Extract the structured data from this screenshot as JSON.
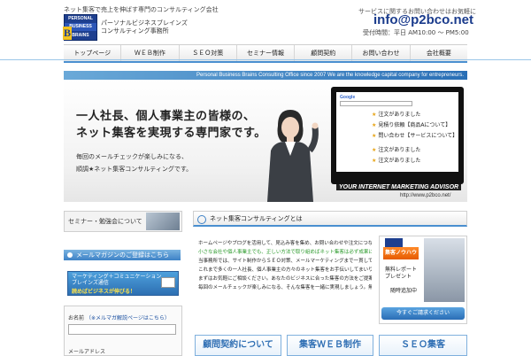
{
  "header": {
    "top_tagline": "ネット集客で売上を伸ばす専門のコンサルティング会社",
    "logo_lines": [
      "PERSONAL",
      "BUSINESS",
      "BRAINS"
    ],
    "logo_big_letter": "B",
    "logo_text_1": "パーソナルビジネスブレインズ",
    "logo_text_2": "コンサルティング事務所",
    "contact_note": "サービスに関するお問い合わせはお気軽に",
    "email": "info@p2bco.net",
    "hours": "受付時間：平日 AM10:00 〜 PM5:00"
  },
  "nav": {
    "items": [
      "トップページ",
      "ＷＥＢ制作",
      "ＳＥＯ対策",
      "セミナー情報",
      "顧問契約",
      "お問い合わせ",
      "会社概要"
    ]
  },
  "banner": {
    "strip_text": "Personal Business Brains Consulting Office since 2007  We are the knowledge capital company for entrepreneurs.",
    "headline_1": "一人社長、個人事業主の皆様の、",
    "headline_2": "ネット集客を実現する専門家です。",
    "sub_1": "毎回のメールチェックが楽しみになる、",
    "sub_2": "順調★ネット集客コンサルティングです。",
    "screen_logo": "Google",
    "screen_rows": [
      "注文がありました",
      "見積り依頼【商品Aについて】",
      "問い合わせ【サービスについて】",
      "注文がありました",
      "注文がありました"
    ],
    "caption": "YOUR INTERNET MARKETING ADVISOR",
    "url": "http://www.p2bco.net/"
  },
  "sidebar": {
    "seminar_label": "セミナー・勉強会について",
    "mail_head": "メールマガジンのご登録はこちら",
    "mail_banner_1": "マーケティング＋コミュニケーション",
    "mail_banner_2": "ブレインズ通信",
    "mail_banner_3": "読めばビジネスが伸びる！",
    "form_name_label": "お名前",
    "form_name_link": "（※メルマガ解説ページはこちら）",
    "form_email_label": "メールアドレス"
  },
  "main": {
    "heading": "ネット集客コンサルティングとは",
    "paragraphs": [
      {
        "text": "ホームページやブログを活用して、見込み客を集め、お問い合わせや注文につなげるための仕組みをつくります。",
        "green": false
      },
      {
        "text": "小さな会社や個人事業主でも、正しい方法で取り組めばネット集客は必ず成果につながります。",
        "green": true
      },
      {
        "text": "当事務所では、サイト制作からＳＥＯ対策、メールマーケティングまで一貫してサポートいたします。",
        "green": false
      },
      {
        "text": "これまで多くの一人社長、個人事業主の方々のネット集客をお手伝いしてまいりました。",
        "green": false
      },
      {
        "text": "まずはお気軽にご相談ください。あなたのビジネスに合った集客の方法をご提案いたします。",
        "green": false
      },
      {
        "text": "毎回のメールチェックが楽しみになる、そんな集客を一緒に実現しましょう。無料相談も受付中です。",
        "green": false
      }
    ],
    "ad": {
      "badge": "集客ノウハウ",
      "line_1": "無料レポート",
      "line_2": "プレゼント",
      "line_3": "随時追加中",
      "button": "今すぐご請求ください"
    },
    "cards": [
      "顧問契約について",
      "集客ＷＥＢ制作",
      "ＳＥＯ集客"
    ]
  },
  "colors": {
    "accent_blue": "#4a8fd0",
    "brand_navy": "#1a3b8c",
    "highlight_green": "#2b9a2b"
  }
}
